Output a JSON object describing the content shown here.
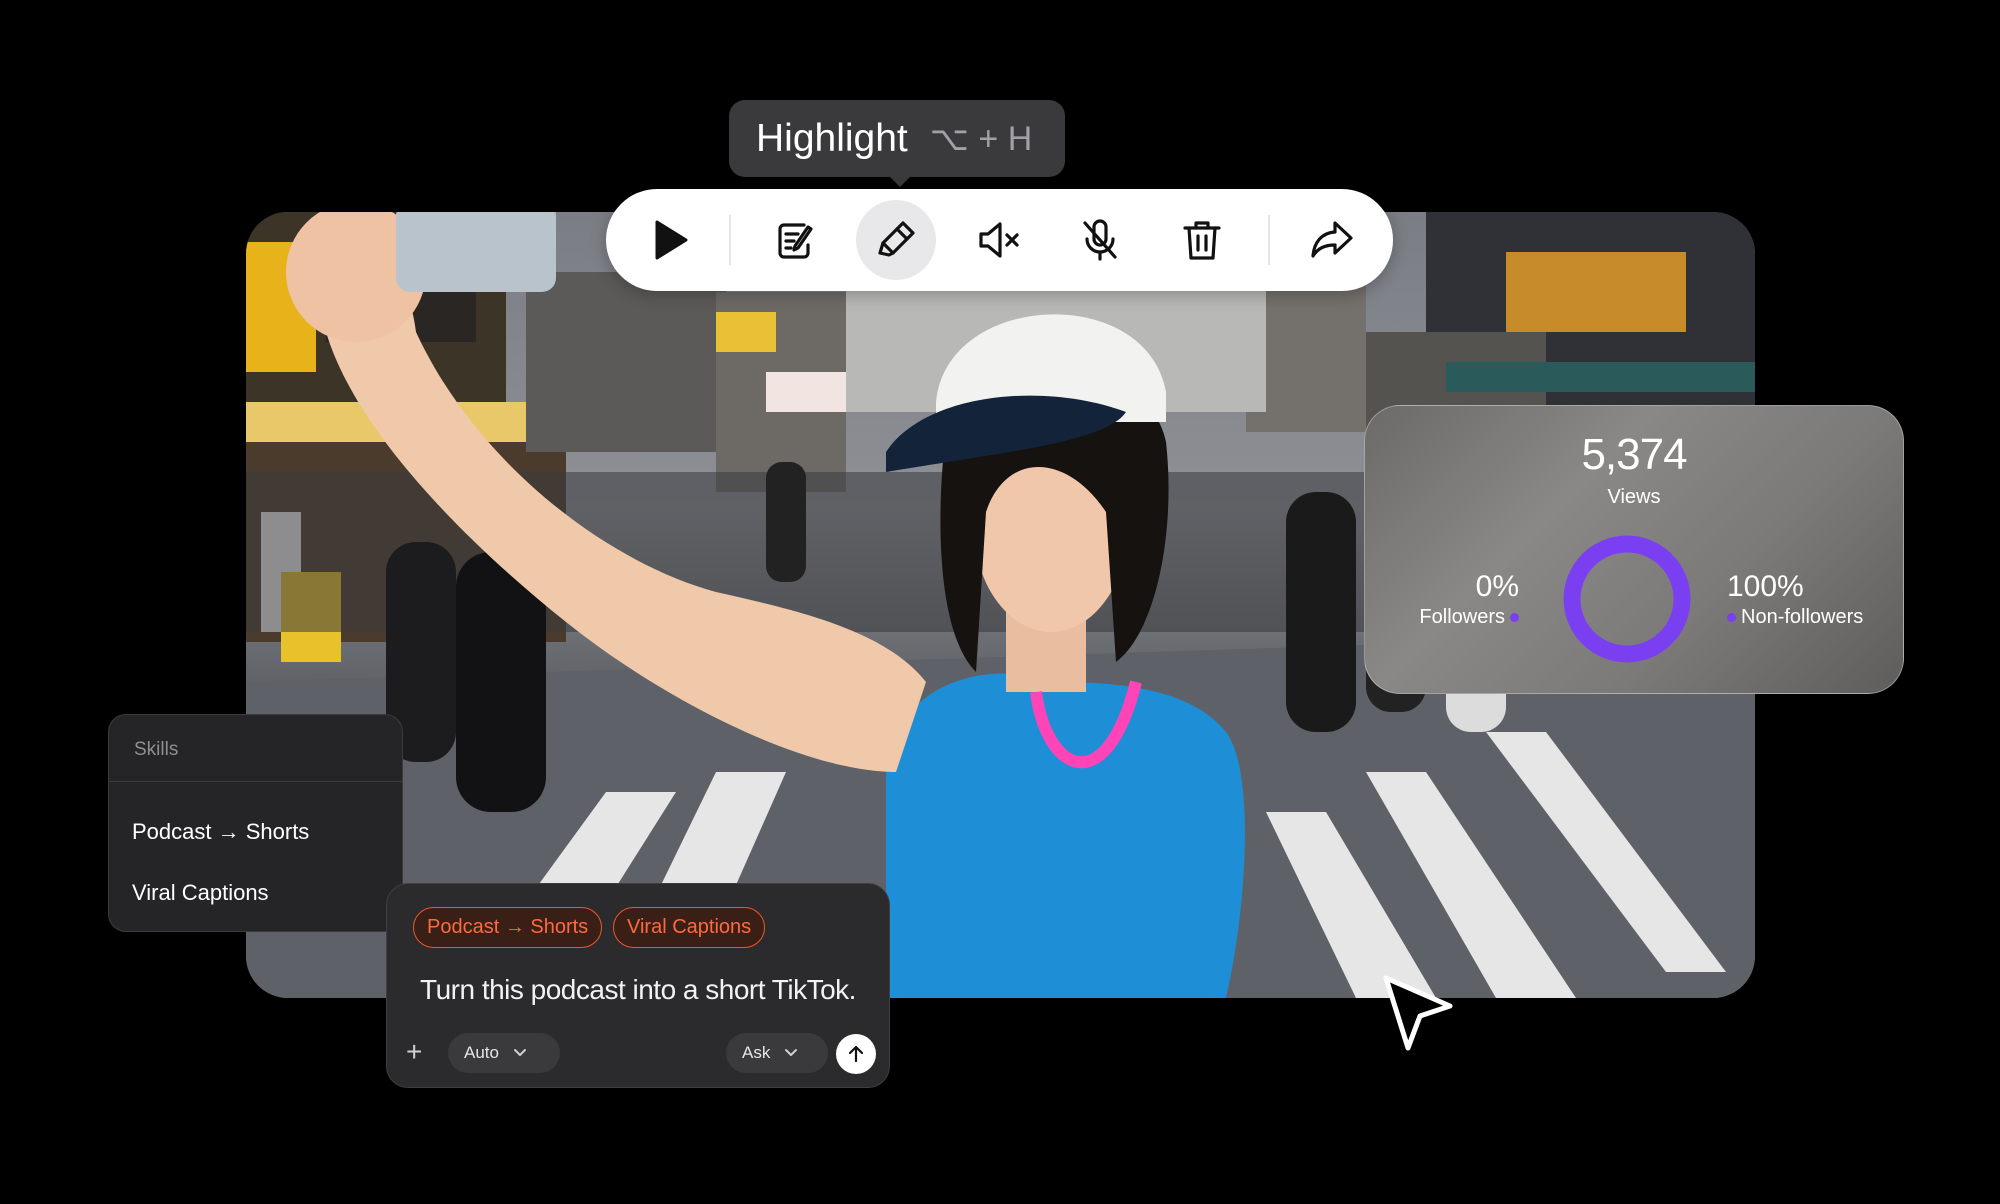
{
  "tooltip": {
    "label": "Highlight",
    "shortcut": "⌥ + H"
  },
  "toolbar": {
    "buttons": [
      "play",
      "edit-notes",
      "highlight",
      "mute-audio",
      "mute-mic",
      "delete",
      "share"
    ],
    "active": "highlight"
  },
  "stats": {
    "views_value": "5,374",
    "views_label": "Views",
    "followers_pct": "0%",
    "followers_label": "Followers",
    "nonfollowers_pct": "100%",
    "nonfollowers_label": "Non-followers",
    "followers_share": 0,
    "nonfollowers_share": 100,
    "accent_color": "#7b3ff2"
  },
  "skills": {
    "header": "Skills",
    "items": [
      "Podcast → Shorts",
      "Viral Captions"
    ]
  },
  "prompt": {
    "chips": [
      "Podcast → Shorts",
      "Viral Captions"
    ],
    "text": "Turn this podcast into a short TikTok.",
    "mode_select": "Auto",
    "action_select": "Ask",
    "chip_color": "#ff6a3d"
  }
}
